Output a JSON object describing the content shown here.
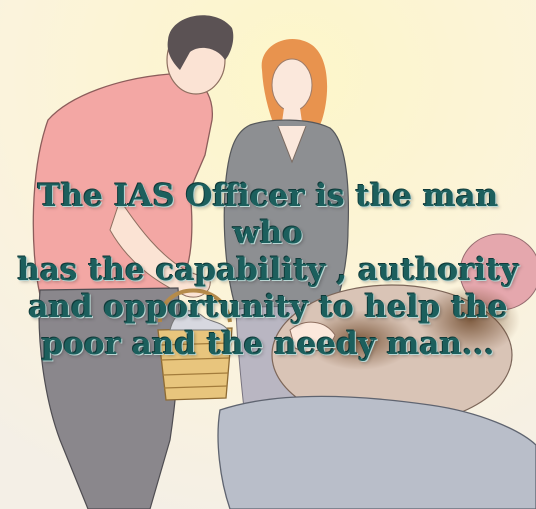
{
  "caption": {
    "lines": [
      "The IAS Officer is the man who",
      "has the capability , authority",
      "and opportunity to help the",
      "poor and the needy man..."
    ]
  },
  "colors": {
    "background": "#fbf6e3",
    "caption_text": "#1c5f5d",
    "man_shirt": "#f3a7a4",
    "woman_hair": "#e8934e",
    "woman_top": "#8d8f92",
    "basket": "#e8c57d",
    "blanket": "#7d5a3b"
  }
}
